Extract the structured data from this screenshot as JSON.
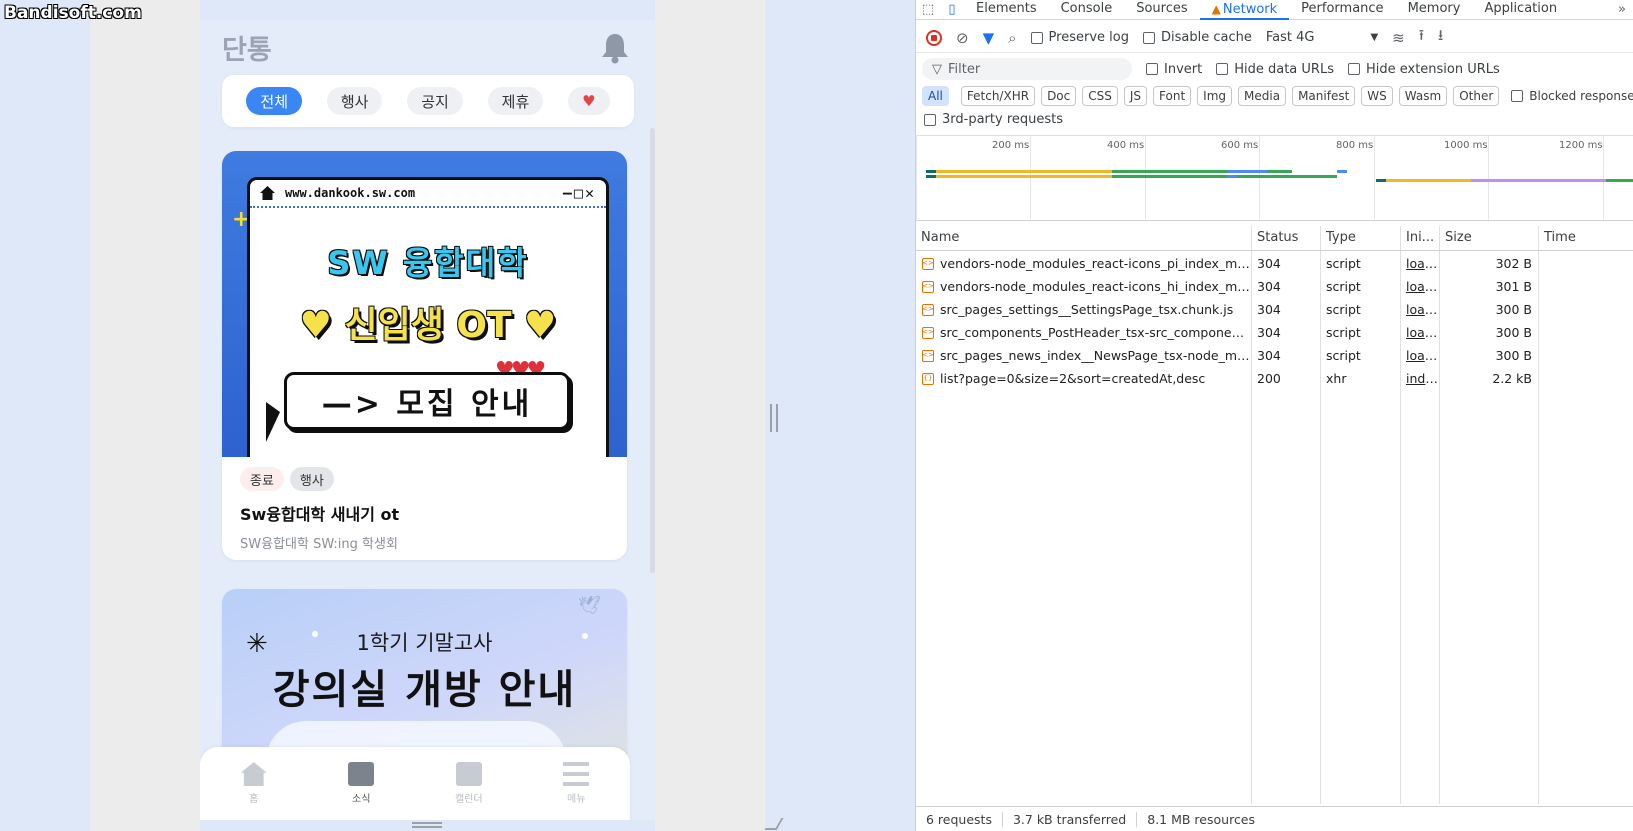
{
  "watermark": "Bandisoft.com",
  "app": {
    "title": "단통",
    "filters": [
      {
        "label": "전체",
        "active": true
      },
      {
        "label": "행사",
        "active": false
      },
      {
        "label": "공지",
        "active": false
      },
      {
        "label": "제휴",
        "active": false
      },
      {
        "label": "♥",
        "active": false
      }
    ],
    "cards": [
      {
        "banner": {
          "url": "www.dankook.sw.com",
          "controls": "—□✕",
          "line1": "SW 융합대학",
          "line2": "♥ 신입생 OT ♥",
          "button": "—> 모집 안내",
          "hearts": "♥♥♥"
        },
        "status_tag": "종료",
        "category_tag": "행사",
        "title": "Sw융합대학 새내기 ot",
        "subtitle": "SW융합대학 SW:ing 학생회"
      },
      {
        "banner": {
          "small": "1학기 기말고사",
          "big": "강의실 개방 안내"
        }
      }
    ],
    "bottom_nav": [
      {
        "label": "홈",
        "icon": "home-icon",
        "active": false
      },
      {
        "label": "소식",
        "icon": "news-icon",
        "active": true
      },
      {
        "label": "캘린더",
        "icon": "calendar-icon",
        "active": false
      },
      {
        "label": "메뉴",
        "icon": "menu-icon",
        "active": false
      }
    ]
  },
  "devtools": {
    "tabs": [
      {
        "label": "Elements",
        "active": false
      },
      {
        "label": "Console",
        "active": false
      },
      {
        "label": "Sources",
        "active": false
      },
      {
        "label": "Network",
        "active": true,
        "warning": true
      },
      {
        "label": "Performance",
        "active": false
      },
      {
        "label": "Memory",
        "active": false
      },
      {
        "label": "Application",
        "active": false
      }
    ],
    "toolbar": {
      "preserve_log": "Preserve log",
      "disable_cache": "Disable cache",
      "throttling": "Fast 4G"
    },
    "filter": {
      "placeholder": "Filter",
      "invert": "Invert",
      "hide_data_urls": "Hide data URLs",
      "hide_extension_urls": "Hide extension URLs"
    },
    "types": [
      "All",
      "Fetch/XHR",
      "Doc",
      "CSS",
      "JS",
      "Font",
      "Img",
      "Media",
      "Manifest",
      "WS",
      "Wasm",
      "Other"
    ],
    "blocked_responses": "Blocked response",
    "third_party": "3rd-party requests",
    "overview_ticks": [
      "200 ms",
      "400 ms",
      "600 ms",
      "800 ms",
      "1000 ms",
      "1200 ms"
    ],
    "columns": {
      "name": "Name",
      "status": "Status",
      "type": "Type",
      "initiator": "Ini...",
      "size": "Size",
      "time": "Time"
    },
    "requests": [
      {
        "name": "vendors-node_modules_react-icons_pi_index_mjs....",
        "status": "304",
        "type": "script",
        "initiator": "load s",
        "size": "302 B"
      },
      {
        "name": "vendors-node_modules_react-icons_hi_index_mjs....",
        "status": "304",
        "type": "script",
        "initiator": "load s",
        "size": "301 B"
      },
      {
        "name": "src_pages_settings__SettingsPage_tsx.chunk.js",
        "status": "304",
        "type": "script",
        "initiator": "load s",
        "size": "300 B"
      },
      {
        "name": "src_components_PostHeader_tsx-src_components_...",
        "status": "304",
        "type": "script",
        "initiator": "load s",
        "size": "300 B"
      },
      {
        "name": "src_pages_news_index__NewsPage_tsx-node_mod...",
        "status": "304",
        "type": "script",
        "initiator": "load s",
        "size": "300 B"
      },
      {
        "name": "list?page=0&size=2&sort=createdAt,desc",
        "status": "200",
        "type": "xhr",
        "initiator": "index",
        "size": "2.2 kB"
      }
    ],
    "status_bar": {
      "requests": "6 requests",
      "transferred": "3.7 kB transferred",
      "resources": "8.1 MB resources"
    },
    "colors": {
      "accent": "#1a73e8",
      "record": "#d93025",
      "warning": "#e37400"
    }
  }
}
